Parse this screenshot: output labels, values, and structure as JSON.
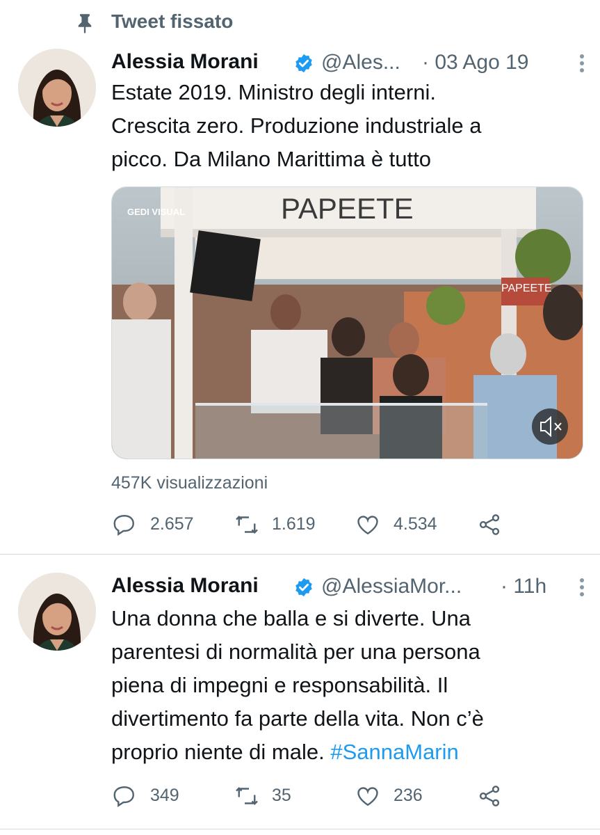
{
  "pinned": {
    "label": "Tweet fissato",
    "icon": "pin-icon"
  },
  "tweets": [
    {
      "author": {
        "name": "Alessia Morani",
        "handle": "@Ales...",
        "verified_icon": "verified-badge-icon"
      },
      "date": "03 Ago 19",
      "text_lines": [
        "Estate 2019. Ministro degli interni.",
        "Crescita zero. Produzione industriale a",
        "picco. Da Milano Marittima è tutto"
      ],
      "media": {
        "type": "video",
        "sign_top": "PAPEETE",
        "sign_small": "PAPEETE",
        "watermark": "GEDI VISUAL",
        "mute_icon": "volume-mute-icon"
      },
      "views": "457K visualizzazioni",
      "stats": {
        "replies": "2.657",
        "retweets": "1.619",
        "likes": "4.534"
      }
    },
    {
      "author": {
        "name": "Alessia Morani",
        "handle": "@AlessiaMor...",
        "verified_icon": "verified-badge-icon"
      },
      "date": "11h",
      "text_lines": [
        "Una donna che balla e si diverte. Una",
        "parentesi di normalità per una persona",
        "piena di impegni e responsabilità. Il",
        "divertimento fa parte della vita. Non c’è",
        "proprio niente di male."
      ],
      "hashtag": "#SannaMarin",
      "stats": {
        "replies": "349",
        "retweets": "35",
        "likes": "236"
      }
    }
  ],
  "colors": {
    "text": "#0f1419",
    "secondary": "#536471",
    "link": "#1d9bf0",
    "verified": "#1d9bf0",
    "divider": "#cfd9de"
  }
}
